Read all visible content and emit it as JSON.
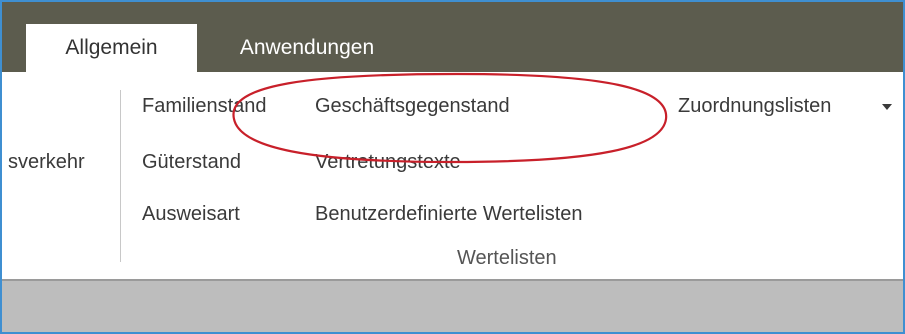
{
  "tabs": [
    {
      "label": "Allgemein",
      "selected": true
    },
    {
      "label": "Anwendungen",
      "selected": false
    }
  ],
  "ribbon": {
    "left_fragment": "sverkehr",
    "commands": {
      "familienstand": "Familienstand",
      "gueterstand": "Güterstand",
      "ausweisart": "Ausweisart",
      "geschaeftsgegenstand": "Geschäftsgegenstand",
      "vertretungstexte": "Vertretungstexte",
      "benutzerdefinierte": "Benutzerdefinierte Wertelisten",
      "zuordnungslisten": "Zuordnungslisten"
    },
    "group_label": "Wertelisten"
  },
  "colors": {
    "tabbar": "#5c5c4e",
    "frame_border": "#3f8fd1",
    "annotation": "#c8202a",
    "status_area": "#bdbdbd"
  },
  "icons": {
    "dropdown": "chevron-down-icon"
  }
}
